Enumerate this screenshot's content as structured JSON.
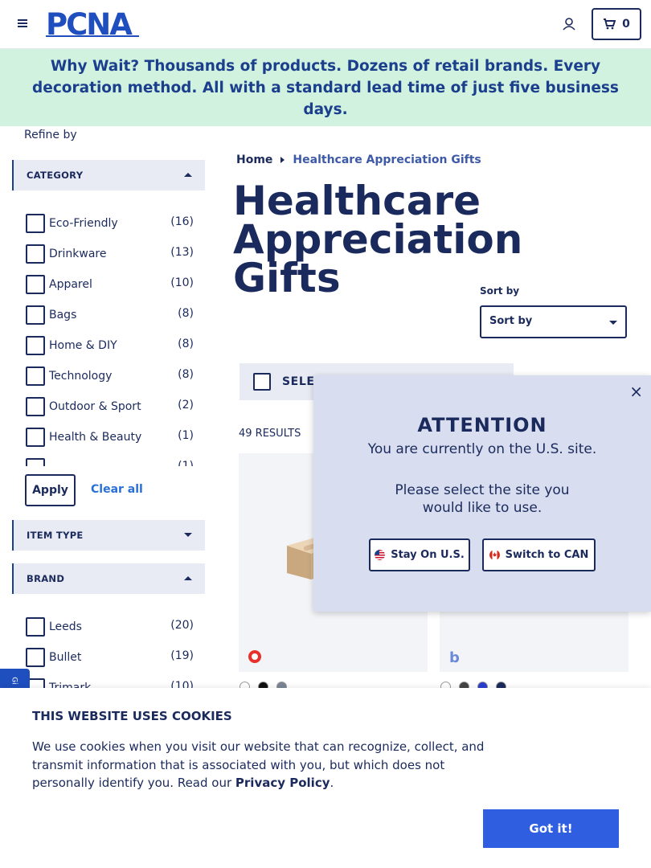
{
  "header": {
    "logo_text": "PCNA",
    "cart_count": "0"
  },
  "promo": {
    "lead": "Why Wait?",
    "text": " Thousands of products. Dozens of retail brands. Every decoration method. All with a standard lead time of just five business days."
  },
  "sidebar": {
    "refine_label": "Refine by",
    "category": {
      "title": "CATEGORY",
      "items": [
        {
          "label": "Eco-Friendly",
          "count": "(16)"
        },
        {
          "label": "Drinkware",
          "count": "(13)"
        },
        {
          "label": "Apparel",
          "count": "(10)"
        },
        {
          "label": "Bags",
          "count": "(8)"
        },
        {
          "label": "Home & DIY",
          "count": "(8)"
        },
        {
          "label": "Technology",
          "count": "(8)"
        },
        {
          "label": "Outdoor & Sport",
          "count": "(2)"
        },
        {
          "label": "Health & Beauty",
          "count": "(1)"
        },
        {
          "label": "",
          "count": "(1)"
        }
      ]
    },
    "apply_label": "Apply",
    "clear_label": "Clear all",
    "item_type": {
      "title": "ITEM TYPE"
    },
    "brand": {
      "title": "BRAND",
      "items": [
        {
          "label": "Leeds",
          "count": "(20)"
        },
        {
          "label": "Bullet",
          "count": "(19)"
        },
        {
          "label": "Trimark",
          "count": "(10)"
        }
      ]
    },
    "side_tab": "Gi"
  },
  "main": {
    "breadcrumb": {
      "home": "Home",
      "current": "Healthcare Appreciation Gifts"
    },
    "title": "Healthcare Appreciation Gifts",
    "sort_label": "Sort by",
    "sort_value": "Sort by",
    "select_text": "SELEC",
    "results": "49 RESULTS",
    "card1_swatches": [
      "#ffffff",
      "#111111",
      "#7a8595"
    ],
    "card2_swatches": [
      "#ffffff",
      "#444444",
      "#2a3fcf",
      "#1b2a5c"
    ]
  },
  "modal": {
    "title": "ATTENTION",
    "line1": "You are currently on the U.S. site.",
    "line2": "Please select the site you would like to use.",
    "stay_label": "Stay On U.S.",
    "switch_label": "Switch to CAN",
    "close": "×"
  },
  "cookie": {
    "title": "THIS WEBSITE USES COOKIES",
    "body": "We use cookies when you visit our website that can recognize, collect, and transmit information that is associated with you, but which does not personally identify you. Read our ",
    "link": "Privacy Policy",
    "tail": ".",
    "button": "Got it!"
  },
  "colors": {
    "brand_navy": "#1b2a5c",
    "promo_bg": "#d2f2e0",
    "accent_blue": "#2f5fe0"
  }
}
